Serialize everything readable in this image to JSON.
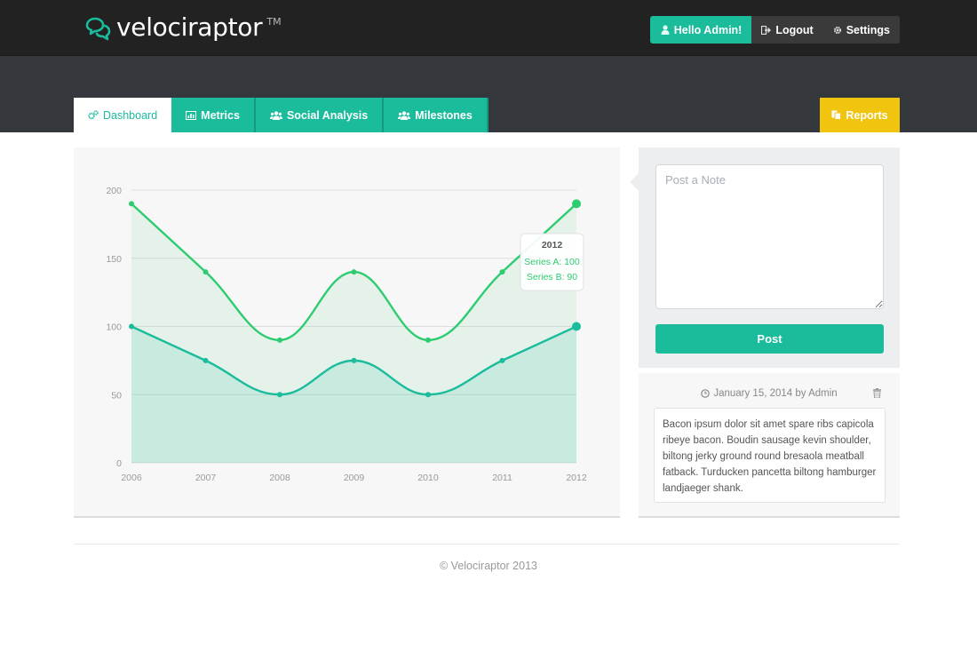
{
  "header": {
    "brand_name": "velociraptor",
    "brand_tm": "TM",
    "hello_label": "Hello Admin!",
    "logout_label": "Logout",
    "settings_label": "Settings"
  },
  "tabs": [
    {
      "label": "Dashboard",
      "icon": "cogs-icon",
      "active": true
    },
    {
      "label": "Metrics",
      "icon": "bar-chart-icon",
      "active": false
    },
    {
      "label": "Social Analysis",
      "icon": "users-icon",
      "active": false
    },
    {
      "label": "Milestones",
      "icon": "users-icon",
      "active": false
    }
  ],
  "reports_tab": {
    "label": "Reports",
    "icon": "reports-icon"
  },
  "colors": {
    "accent": "#1abc9c",
    "series_a": "#2ecc71",
    "series_b": "#1abc9c",
    "reports": "#f1c40f",
    "topbar": "#222222",
    "subbar": "#34383d"
  },
  "chart_data": {
    "type": "area",
    "x": [
      "2006",
      "2007",
      "2008",
      "2009",
      "2010",
      "2011",
      "2012"
    ],
    "series": [
      {
        "name": "Series A",
        "values": [
          190,
          140,
          90,
          140,
          90,
          140,
          190
        ]
      },
      {
        "name": "Series B",
        "values": [
          100,
          75,
          50,
          75,
          50,
          75,
          100
        ]
      }
    ],
    "yticks": [
      0,
      50,
      100,
      150,
      200
    ],
    "ylim": [
      0,
      200
    ],
    "grid": true,
    "hover_index": 6,
    "tooltip": {
      "title": "2012",
      "series_a": "Series A: 100",
      "series_b": "Series B: 90"
    }
  },
  "note": {
    "placeholder": "Post a Note",
    "post_label": "Post"
  },
  "feed": {
    "meta": "January 15, 2014 by Admin",
    "body": "Bacon ipsum dolor sit amet spare ribs capicola ribeye bacon. Boudin sausage kevin shoulder, biltong jerky ground round bresaola meatball fatback. Turducken pancetta biltong hamburger landjaeger shank."
  },
  "footer": {
    "text": "© Velociraptor 2013"
  }
}
